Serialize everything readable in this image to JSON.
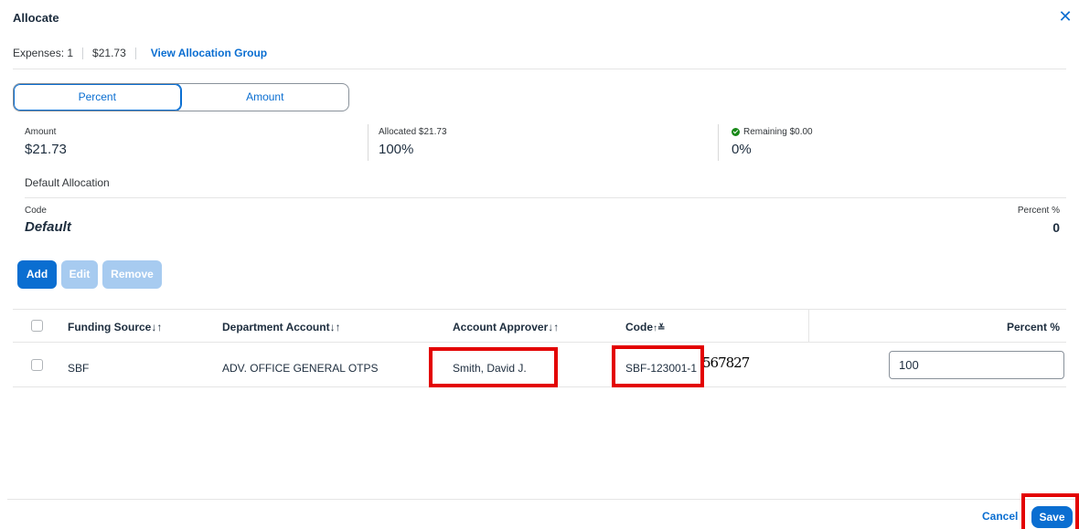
{
  "dialog": {
    "title": "Allocate",
    "close_icon": "close-icon"
  },
  "summary": {
    "expenses": "Expenses: 1",
    "amount": "$21.73",
    "view_group_link": "View Allocation Group"
  },
  "toggle": {
    "percent_label": "Percent",
    "amount_label": "Amount",
    "selected": "Percent"
  },
  "stats": {
    "amount_label": "Amount",
    "amount_value": "$21.73",
    "allocated_label": "Allocated $21.73",
    "allocated_value": "100%",
    "remaining_label": "Remaining $0.00",
    "remaining_value": "0%",
    "remaining_status_color": "#188918"
  },
  "default_allocation": {
    "heading": "Default Allocation",
    "code_label": "Code",
    "code_value": "Default",
    "percent_label": "Percent %",
    "percent_value": "0"
  },
  "actions": {
    "add": "Add",
    "edit": "Edit",
    "remove": "Remove"
  },
  "table": {
    "headers": {
      "funding_source": "Funding Source",
      "department_account": "Department Account",
      "account_approver": "Account Approver",
      "code": "Code",
      "percent": "Percent %",
      "sort_icon": "↓↑",
      "code_sort_icon": "↑≚"
    },
    "rows": [
      {
        "funding_source": "SBF",
        "department_account": "ADV. OFFICE GENERAL OTPS",
        "account_approver": "Smith, David J.",
        "code": "SBF-123001-1",
        "percent": "100"
      }
    ]
  },
  "overlay_text": "567827",
  "footer": {
    "cancel": "Cancel",
    "save": "Save"
  },
  "colors": {
    "accent": "#0a6ed1",
    "disabled_button": "#a7cbf0",
    "highlight_box": "#e30000"
  }
}
